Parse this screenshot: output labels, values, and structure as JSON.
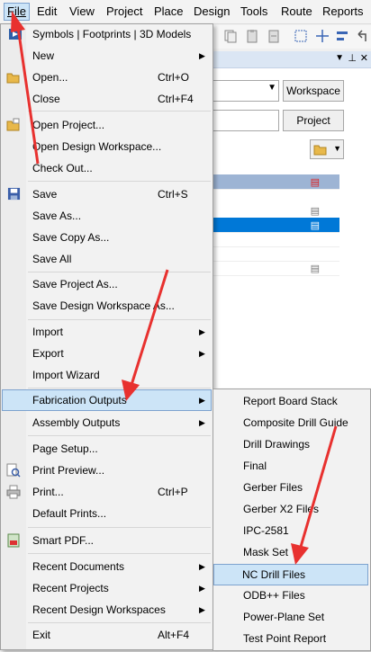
{
  "menubar": {
    "items": [
      "File",
      "Edit",
      "View",
      "Project",
      "Place",
      "Design",
      "Tools",
      "Route",
      "Reports"
    ]
  },
  "panel": {
    "workspace_button": "Workspace",
    "project_button": "Project"
  },
  "file_menu": {
    "items": [
      {
        "label": "Symbols | Footprints | 3D Models",
        "shortcut": "",
        "submenu": false
      },
      {
        "label": "New",
        "shortcut": "",
        "submenu": true
      },
      {
        "label": "Open...",
        "shortcut": "Ctrl+O",
        "submenu": false
      },
      {
        "label": "Close",
        "shortcut": "Ctrl+F4",
        "submenu": false
      },
      {
        "label": "Open Project...",
        "shortcut": "",
        "submenu": false
      },
      {
        "label": "Open Design Workspace...",
        "shortcut": "",
        "submenu": false
      },
      {
        "label": "Check Out...",
        "shortcut": "",
        "submenu": false
      },
      {
        "label": "Save",
        "shortcut": "Ctrl+S",
        "submenu": false
      },
      {
        "label": "Save As...",
        "shortcut": "",
        "submenu": false
      },
      {
        "label": "Save Copy As...",
        "shortcut": "",
        "submenu": false
      },
      {
        "label": "Save All",
        "shortcut": "",
        "submenu": false
      },
      {
        "label": "Save Project As...",
        "shortcut": "",
        "submenu": false
      },
      {
        "label": "Save Design Workspace As...",
        "shortcut": "",
        "submenu": false
      },
      {
        "label": "Import",
        "shortcut": "",
        "submenu": true
      },
      {
        "label": "Export",
        "shortcut": "",
        "submenu": true
      },
      {
        "label": "Import Wizard",
        "shortcut": "",
        "submenu": false
      },
      {
        "label": "Fabrication Outputs",
        "shortcut": "",
        "submenu": true
      },
      {
        "label": "Assembly Outputs",
        "shortcut": "",
        "submenu": true
      },
      {
        "label": "Page Setup...",
        "shortcut": "",
        "submenu": false
      },
      {
        "label": "Print Preview...",
        "shortcut": "",
        "submenu": false
      },
      {
        "label": "Print...",
        "shortcut": "Ctrl+P",
        "submenu": false
      },
      {
        "label": "Default Prints...",
        "shortcut": "",
        "submenu": false
      },
      {
        "label": "Smart PDF...",
        "shortcut": "",
        "submenu": false
      },
      {
        "label": "Recent Documents",
        "shortcut": "",
        "submenu": true
      },
      {
        "label": "Recent Projects",
        "shortcut": "",
        "submenu": true
      },
      {
        "label": "Recent Design Workspaces",
        "shortcut": "",
        "submenu": true
      },
      {
        "label": "Exit",
        "shortcut": "Alt+F4",
        "submenu": false
      }
    ]
  },
  "fabrication_submenu": {
    "items": [
      "Report Board Stack",
      "Composite Drill Guide",
      "Drill Drawings",
      "Final",
      "Gerber Files",
      "Gerber X2 Files",
      "IPC-2581",
      "Mask Set",
      "NC Drill Files",
      "ODB++ Files",
      "Power-Plane Set",
      "Test Point Report"
    ]
  },
  "colors": {
    "highlight": "#cce4f7",
    "highlight_border": "#7da2ce",
    "annotation_arrow": "#e8312f"
  }
}
